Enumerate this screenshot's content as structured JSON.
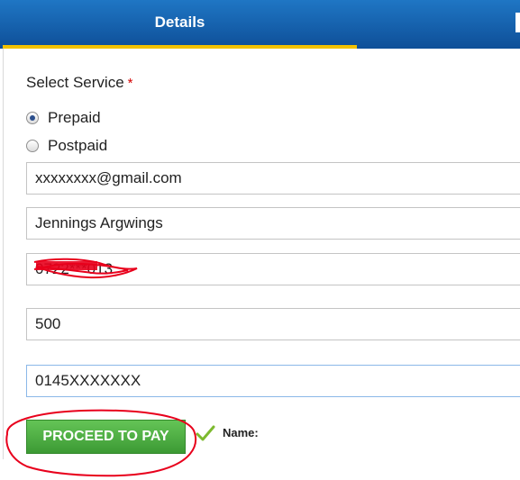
{
  "tabs": {
    "active_label": "Details"
  },
  "form": {
    "service_label": "Select Service",
    "required_marker": "*",
    "options": [
      {
        "label": "Prepaid",
        "selected": true
      },
      {
        "label": "Postpaid",
        "selected": false
      }
    ],
    "email_value": "xxxxxxxx@gmail.com",
    "name_value": "Jennings Argwings",
    "phone_value": "0722***013",
    "amount_value": "500",
    "account_value": "0145XXXXXXX",
    "submit_label": "PROCEED TO PAY",
    "name_status_label": "Name:"
  },
  "colors": {
    "header_blue": "#1565b5",
    "tab_underline": "#f2c200",
    "button_green": "#4caf3f",
    "annotation_red": "#e8001c"
  }
}
